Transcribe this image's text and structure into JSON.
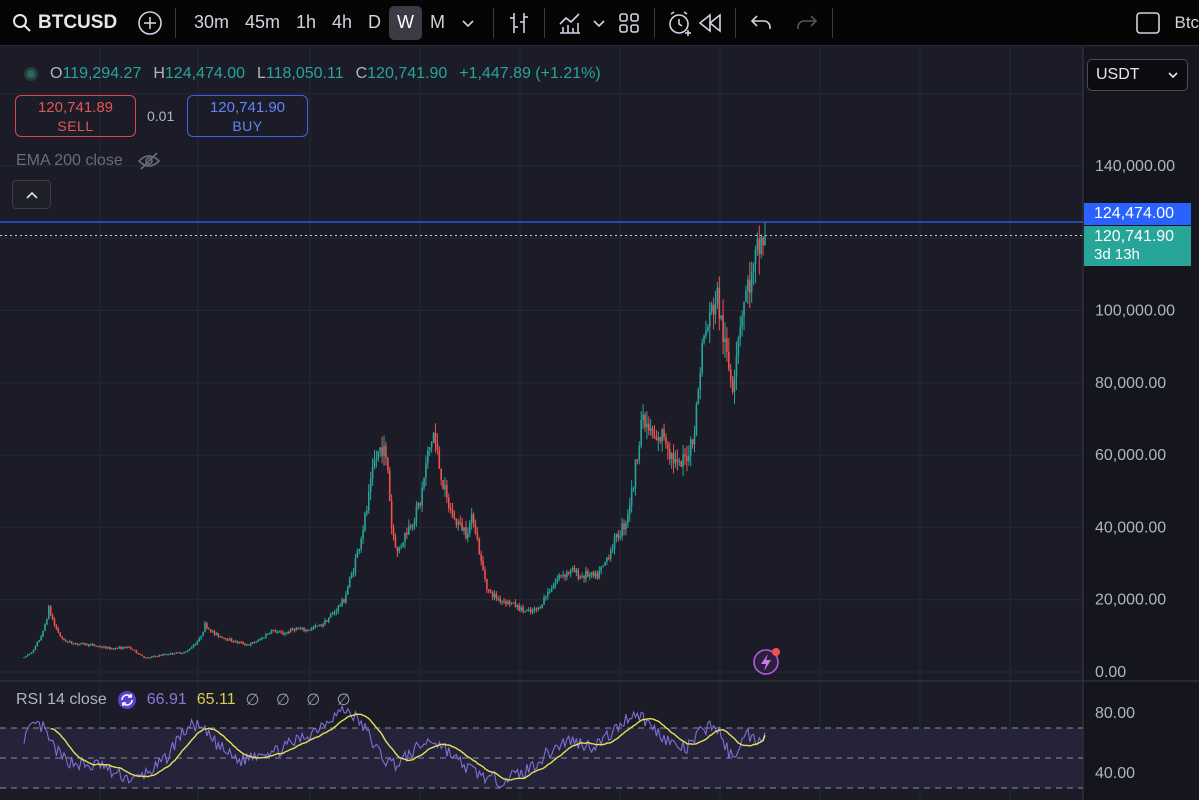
{
  "toolbar": {
    "symbol": "BTCUSD",
    "intervals": [
      "30m",
      "45m",
      "1h",
      "4h",
      "D",
      "W",
      "M"
    ],
    "active_interval": "W",
    "right_text": "Btc"
  },
  "legend": {
    "o_label": "O",
    "open": "119,294.27",
    "h_label": "H",
    "high": "124,474.00",
    "l_label": "L",
    "low": "118,050.11",
    "c_label": "C",
    "close": "120,741.90",
    "change": "+1,447.89 (+1.21%)"
  },
  "trade": {
    "sell_price": "120,741.89",
    "sell_label": "SELL",
    "quantity": "0.01",
    "buy_price": "120,741.90",
    "buy_label": "BUY"
  },
  "ema_label": "EMA 200 close",
  "currency": "USDT",
  "price_tags": {
    "high": "124,474.00",
    "last": "120,741.90",
    "countdown": "3d 13h"
  },
  "rsi": {
    "name": "RSI 14 close",
    "value": "66.91",
    "ma_value": "65.11",
    "na_values": "∅ ∅ ∅ ∅"
  },
  "colors": {
    "background": "#1b1c27",
    "up": "#26a69a",
    "down": "#ef5350",
    "high_line": "#2962ff",
    "rsi_line": "#7e6fd6",
    "rsi_ma": "#e8e05a"
  },
  "icons": [
    "search-icon",
    "add-compare-icon",
    "chevron-down-icon",
    "bar-style-icon",
    "indicators-icon",
    "templates-icon",
    "alert-icon",
    "replay-icon",
    "undo-icon",
    "redo-icon",
    "fullscreen-icon",
    "eye-off-icon",
    "chevron-up-icon",
    "lightning-icon",
    "refresh-icon"
  ],
  "chart_data": [
    {
      "type": "candlestick",
      "interval": "W",
      "ylim": [
        0,
        160000
      ],
      "y_ticks": [
        "140,000.00",
        "100,000.00",
        "80,000.00",
        "60,000.00",
        "40,000.00",
        "20,000.00",
        "0.00"
      ],
      "series_close_approx": [
        [
          0,
          4000
        ],
        [
          5,
          6000
        ],
        [
          10,
          11000
        ],
        [
          13,
          17500
        ],
        [
          16,
          13000
        ],
        [
          20,
          9000
        ],
        [
          25,
          8000
        ],
        [
          35,
          7500
        ],
        [
          45,
          6500
        ],
        [
          55,
          6800
        ],
        [
          64,
          3800
        ],
        [
          75,
          5000
        ],
        [
          85,
          5500
        ],
        [
          92,
          9000
        ],
        [
          95,
          13000
        ],
        [
          100,
          10500
        ],
        [
          105,
          9500
        ],
        [
          110,
          8500
        ],
        [
          118,
          7500
        ],
        [
          124,
          9000
        ],
        [
          130,
          11500
        ],
        [
          136,
          10500
        ],
        [
          142,
          12000
        ],
        [
          148,
          11500
        ],
        [
          156,
          13000
        ],
        [
          162,
          16000
        ],
        [
          168,
          20000
        ],
        [
          172,
          27000
        ],
        [
          176,
          35000
        ],
        [
          180,
          45000
        ],
        [
          184,
          58000
        ],
        [
          188,
          63000
        ],
        [
          191,
          56000
        ],
        [
          193,
          40000
        ],
        [
          196,
          33000
        ],
        [
          200,
          38000
        ],
        [
          204,
          42000
        ],
        [
          208,
          47000
        ],
        [
          212,
          60000
        ],
        [
          215,
          66000
        ],
        [
          218,
          57000
        ],
        [
          222,
          47000
        ],
        [
          226,
          42000
        ],
        [
          232,
          39000
        ],
        [
          236,
          43000
        ],
        [
          240,
          30000
        ],
        [
          244,
          22000
        ],
        [
          250,
          20000
        ],
        [
          256,
          19000
        ],
        [
          262,
          17000
        ],
        [
          266,
          16500
        ],
        [
          270,
          17500
        ],
        [
          276,
          23000
        ],
        [
          282,
          27000
        ],
        [
          288,
          28000
        ],
        [
          292,
          26500
        ],
        [
          296,
          27000
        ],
        [
          300,
          26000
        ],
        [
          304,
          29000
        ],
        [
          308,
          34000
        ],
        [
          312,
          38000
        ],
        [
          316,
          42000
        ],
        [
          320,
          52000
        ],
        [
          324,
          70000
        ],
        [
          328,
          67000
        ],
        [
          332,
          63000
        ],
        [
          336,
          66000
        ],
        [
          340,
          60000
        ],
        [
          344,
          56000
        ],
        [
          348,
          60000
        ],
        [
          352,
          67000
        ],
        [
          356,
          90000
        ],
        [
          360,
          98000
        ],
        [
          364,
          104000
        ],
        [
          366,
          96000
        ],
        [
          370,
          84000
        ],
        [
          372,
          80000
        ],
        [
          375,
          94000
        ],
        [
          378,
          103000
        ],
        [
          381,
          108000
        ],
        [
          383,
          110000
        ],
        [
          386,
          118000
        ],
        [
          389,
          120742
        ]
      ],
      "ath_line": 124474,
      "last_price": 120741.9
    },
    {
      "type": "line",
      "title": "RSI 14 close",
      "series": [
        {
          "name": "RSI",
          "value": 66.91
        },
        {
          "name": "RSI-based MA",
          "value": 65.11
        }
      ],
      "y_ticks": [
        "80.00",
        "40.00"
      ],
      "bands": [
        70,
        50,
        30
      ],
      "rsi_approx": [
        [
          0,
          64
        ],
        [
          6,
          72
        ],
        [
          10,
          70
        ],
        [
          14,
          60
        ],
        [
          20,
          50
        ],
        [
          26,
          47
        ],
        [
          34,
          44
        ],
        [
          40,
          46
        ],
        [
          46,
          40
        ],
        [
          52,
          38
        ],
        [
          58,
          35
        ],
        [
          64,
          40
        ],
        [
          70,
          44
        ],
        [
          76,
          52
        ],
        [
          80,
          62
        ],
        [
          86,
          70
        ],
        [
          90,
          72
        ],
        [
          96,
          66
        ],
        [
          102,
          58
        ],
        [
          108,
          52
        ],
        [
          114,
          48
        ],
        [
          120,
          52
        ],
        [
          126,
          55
        ],
        [
          132,
          54
        ],
        [
          138,
          58
        ],
        [
          144,
          62
        ],
        [
          150,
          66
        ],
        [
          156,
          72
        ],
        [
          162,
          78
        ],
        [
          168,
          82
        ],
        [
          172,
          80
        ],
        [
          176,
          74
        ],
        [
          180,
          68
        ],
        [
          184,
          58
        ],
        [
          190,
          48
        ],
        [
          196,
          46
        ],
        [
          202,
          52
        ],
        [
          208,
          58
        ],
        [
          214,
          62
        ],
        [
          220,
          58
        ],
        [
          226,
          50
        ],
        [
          232,
          44
        ],
        [
          238,
          40
        ],
        [
          244,
          36
        ],
        [
          250,
          35
        ],
        [
          256,
          38
        ],
        [
          262,
          40
        ],
        [
          268,
          46
        ],
        [
          274,
          52
        ],
        [
          280,
          58
        ],
        [
          286,
          62
        ],
        [
          292,
          60
        ],
        [
          298,
          58
        ],
        [
          304,
          62
        ],
        [
          310,
          68
        ],
        [
          316,
          76
        ],
        [
          320,
          80
        ],
        [
          324,
          78
        ],
        [
          330,
          70
        ],
        [
          336,
          64
        ],
        [
          342,
          58
        ],
        [
          348,
          56
        ],
        [
          354,
          66
        ],
        [
          360,
          72
        ],
        [
          364,
          70
        ],
        [
          368,
          58
        ],
        [
          372,
          50
        ],
        [
          376,
          60
        ],
        [
          380,
          66
        ],
        [
          384,
          62
        ],
        [
          389,
          67
        ]
      ]
    }
  ]
}
